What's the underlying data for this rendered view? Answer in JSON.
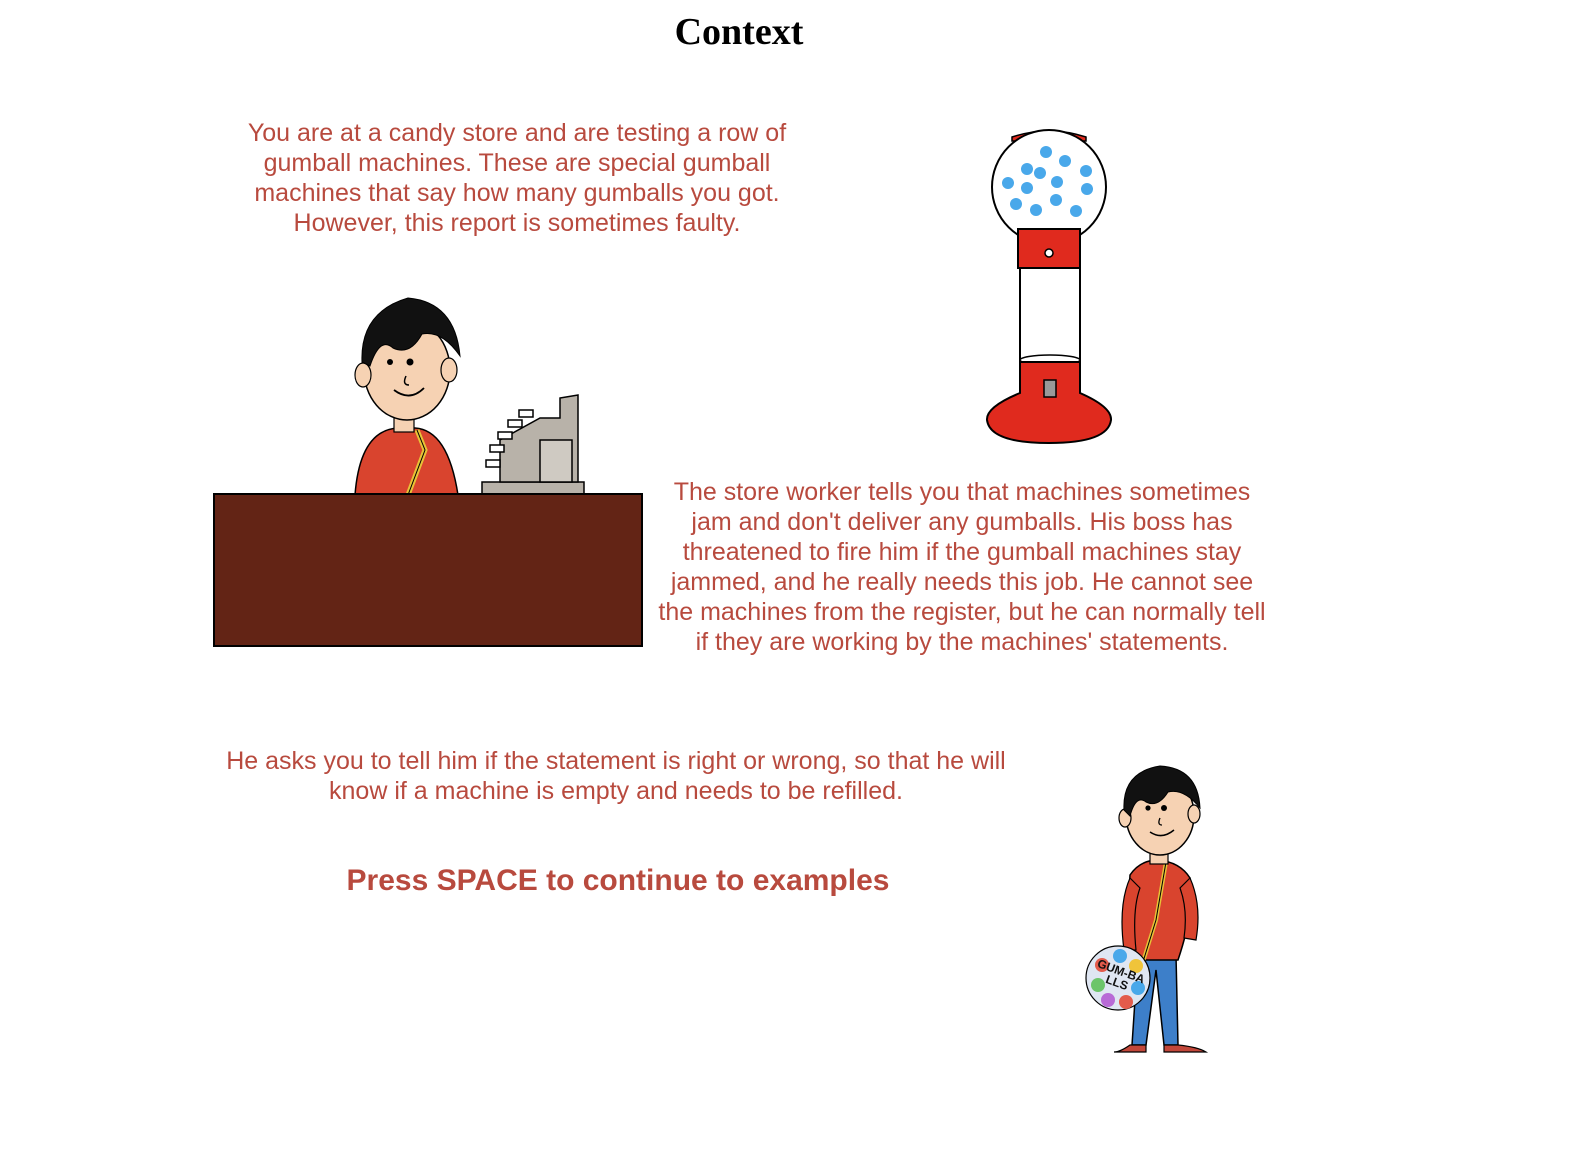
{
  "page": {
    "title": "Context"
  },
  "paragraphs": {
    "intro": "You are at a candy store and are testing a row of gumball machines. These are special gumball machines that say how many gumballs you got. However, this report is sometimes faulty.",
    "worker": "The store worker tells you that machines sometimes jam and don't deliver any gumballs. His boss has threatened to fire him if the gumball machines stay jammed, and he really needs this job. He cannot see the machines from the register, but he can normally tell if they are working by the machines' statements.",
    "request": "He asks you to tell him if the statement is right or wrong, so that he will know if a machine is empty and needs to be refilled."
  },
  "prompt": {
    "continue": "Press SPACE to continue to examples"
  },
  "illustrations": {
    "bag_label": "GUM-BALLS"
  },
  "colors": {
    "text_accent": "#b84a3e",
    "counter": "#632415",
    "shirt": "#d9442e",
    "machine_red": "#e02a1e",
    "gumball_blue": "#49a8ea",
    "register_gray": "#b8b2a9",
    "pants_blue": "#3d7fc9"
  }
}
